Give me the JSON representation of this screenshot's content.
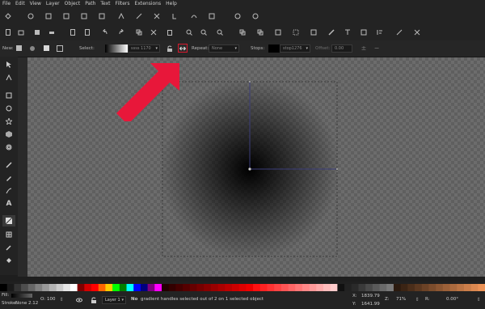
{
  "menu": [
    "File",
    "Edit",
    "View",
    "Layer",
    "Object",
    "Path",
    "Text",
    "Filters",
    "Extensions",
    "Help"
  ],
  "tool_controls": {
    "new_label": "New:",
    "select_label": "Select:",
    "gradient_name": "ssss 1170",
    "repeat_label": "Repeat:",
    "repeat_value": "None",
    "stops_label": "Stops:",
    "stop_value": "stop1276",
    "offset_label": "Offset:",
    "offset_value": "0.00"
  },
  "status": {
    "fill_label": "Fill:",
    "stroke_label": "Stroke:",
    "stroke_value": "None",
    "stroke_width": "2.12",
    "opacity_label": "O:",
    "opacity_value": "100",
    "layer_value": "Layer 1",
    "message_bold": "No",
    "message_rest": "gradient handles selected out of 2 on 1 selected object",
    "x_label": "X:",
    "x_value": "1839.79",
    "y_label": "Y:",
    "y_value": "1641.99",
    "zoom_label": "Z:",
    "zoom_value": "71%",
    "rotation_label": "R:",
    "rotation_value": "0.00°"
  },
  "colors": {
    "accent_red": "#e8173a",
    "highlight_box": "#d61a2e",
    "background": "#1e1e1e"
  },
  "icons": {
    "toolbox": [
      "selector-icon",
      "node-icon",
      "rect-icon",
      "circle-icon",
      "star-icon",
      "3d-box-icon",
      "spiral-icon",
      "pencil-icon",
      "pen-icon",
      "calligraphy-icon",
      "text-icon",
      "gradient-icon",
      "mesh-icon",
      "dropper-icon",
      "paint-bucket-icon"
    ]
  }
}
